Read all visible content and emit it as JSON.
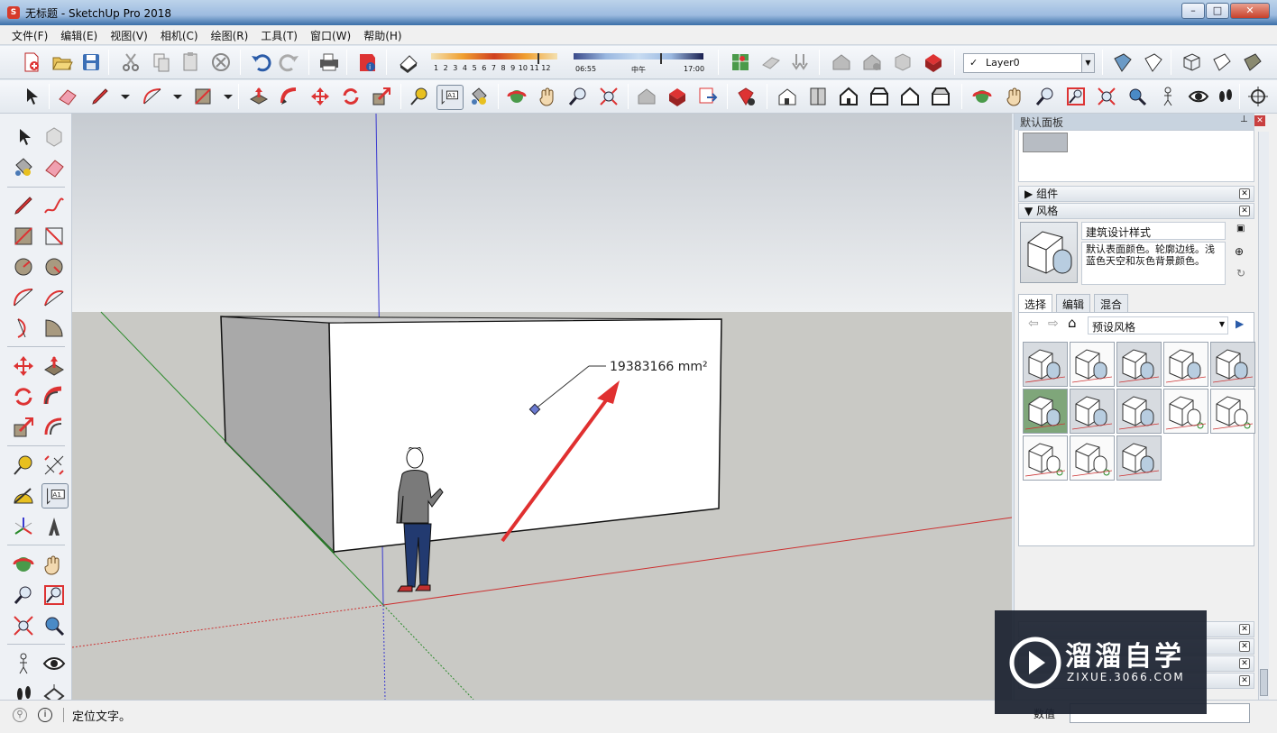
{
  "window": {
    "title": "无标题 - SketchUp Pro 2018",
    "app_icon_text": "S"
  },
  "menu": [
    "文件(F)",
    "编辑(E)",
    "视图(V)",
    "相机(C)",
    "绘图(R)",
    "工具(T)",
    "窗口(W)",
    "帮助(H)"
  ],
  "shadow_settings": {
    "months": [
      "1",
      "2",
      "3",
      "4",
      "5",
      "6",
      "7",
      "8",
      "9",
      "10",
      "11",
      "12"
    ],
    "time_start": "06:55",
    "time_mid": "中午",
    "time_end": "17:00"
  },
  "layer": {
    "current": "Layer0",
    "check": "✓"
  },
  "viewport": {
    "area_label": "19383166 mm²",
    "background": {
      "sky": "#d4d8dd",
      "ground": "#c9c9c5"
    },
    "axis_colors": {
      "blue": "#3a3ad0",
      "green": "#2a8a2a",
      "red": "#cc3030"
    }
  },
  "tray": {
    "title": "默认面板",
    "pin": "📌",
    "panels": [
      {
        "label": "组件",
        "arrow": "▶"
      },
      {
        "label": "风格",
        "arrow": "▼"
      }
    ],
    "style": {
      "name": "建筑设计样式",
      "description": "默认表面颜色。轮廓边线。浅蓝色天空和灰色背景颜色。",
      "tabs": [
        "选择",
        "编辑",
        "混合"
      ],
      "collection": "预设风格"
    },
    "bottom_panels": [
      "",
      "",
      "",
      ""
    ]
  },
  "status": {
    "message": "定位文字。"
  },
  "measurement": {
    "label": "数值",
    "value": ""
  },
  "watermark": {
    "brand": "溜溜自学",
    "url": "ZIXUE.3066.COM"
  }
}
